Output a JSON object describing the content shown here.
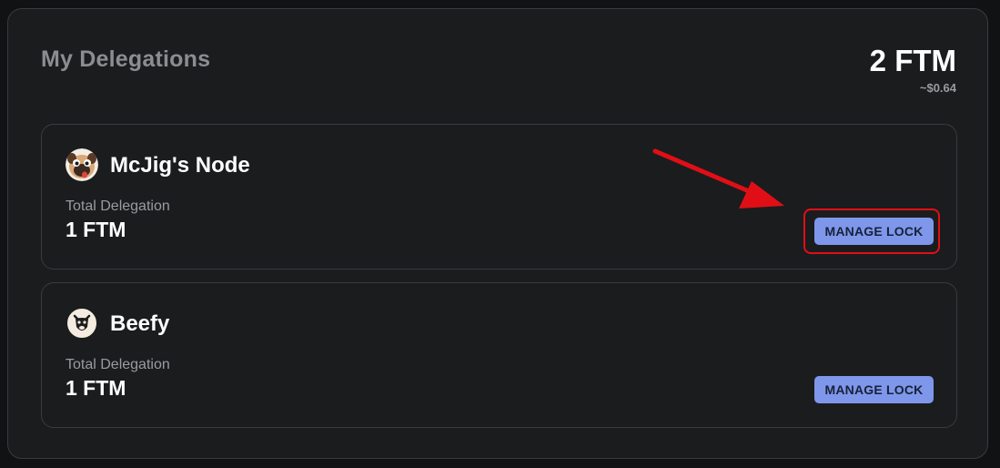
{
  "header": {
    "title": "My Delegations",
    "total_amount": "2 FTM",
    "total_usd": "~$0.64"
  },
  "delegations": [
    {
      "node_name": "McJig's Node",
      "avatar_icon": "pug-dog-icon",
      "label": "Total Delegation",
      "value": "1 FTM",
      "button_label": "MANAGE LOCK"
    },
    {
      "node_name": "Beefy",
      "avatar_icon": "cow-icon",
      "label": "Total Delegation",
      "value": "1 FTM",
      "button_label": "MANAGE LOCK"
    }
  ],
  "annotation": {
    "color": "#e00f16"
  },
  "colors": {
    "panel_bg": "#1b1c1e",
    "button_bg": "#7f97ea",
    "button_text": "#16213a"
  }
}
